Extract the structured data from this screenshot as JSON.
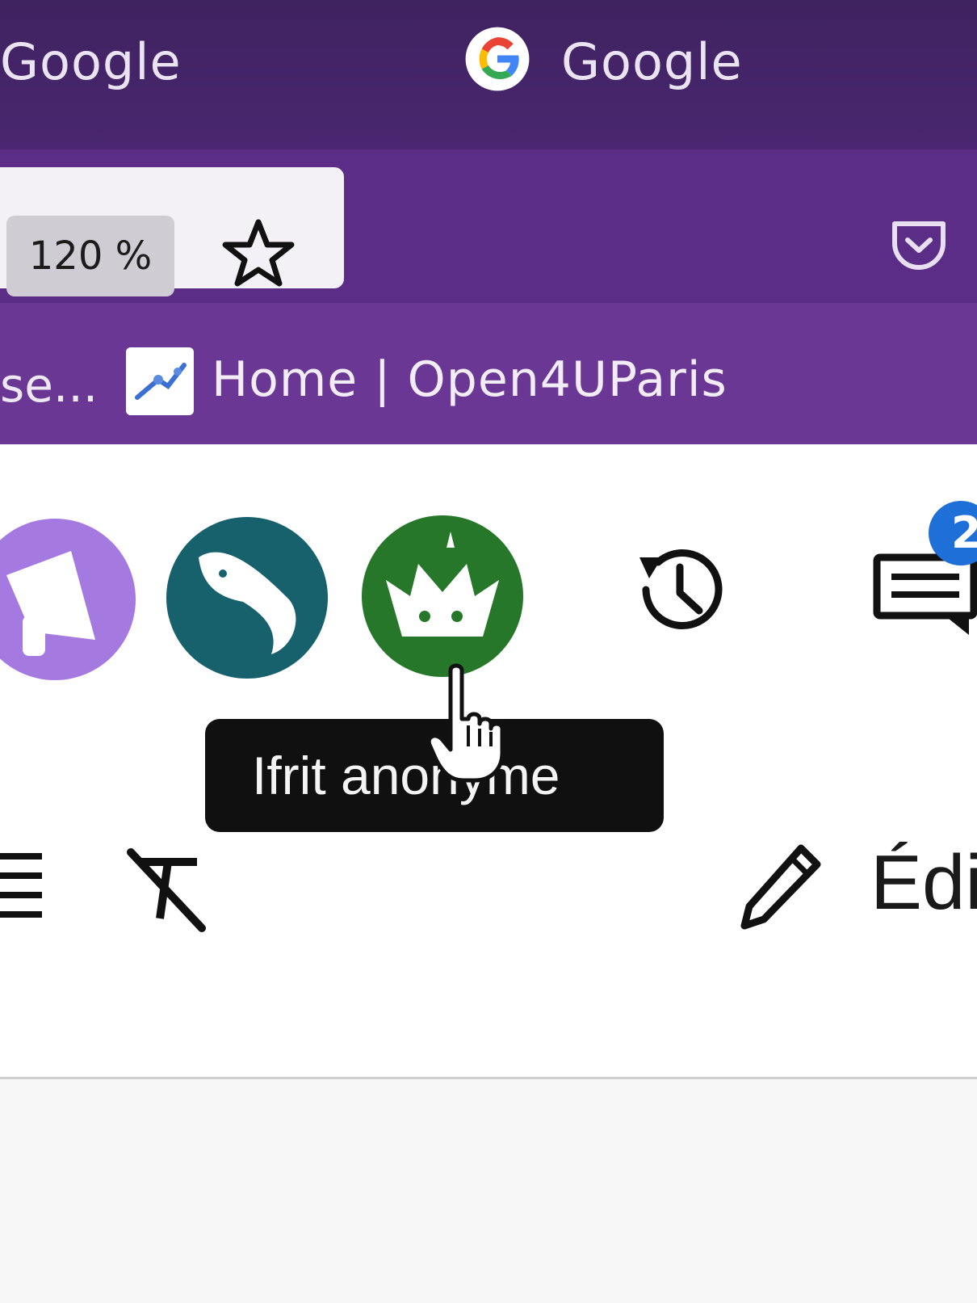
{
  "tabs": {
    "left_title": "Google",
    "active_title": "Google"
  },
  "navbar": {
    "zoom_level": "120 %"
  },
  "bookmarks": {
    "truncated_item": "se...",
    "item_label": "Home | Open4UParis"
  },
  "toolbar": {
    "notification_count": "2"
  },
  "tooltip": {
    "text": "Ifrit anonyme"
  },
  "editor": {
    "edit_label": "Édi"
  },
  "colors": {
    "tab_bar": "#3f2260",
    "nav_bar": "#5b2d86",
    "bookmarks_bar": "#6b3795",
    "avatar_purple": "#a57ae0",
    "avatar_teal": "#17616d",
    "avatar_green": "#26772a",
    "badge_blue": "#1e6fd8"
  },
  "icons": [
    "google-logo-icon",
    "star-icon",
    "pocket-icon",
    "favicon-icon",
    "history-icon",
    "chat-icon",
    "cursor-hand-icon",
    "list-icon",
    "clear-format-icon",
    "pencil-icon"
  ]
}
